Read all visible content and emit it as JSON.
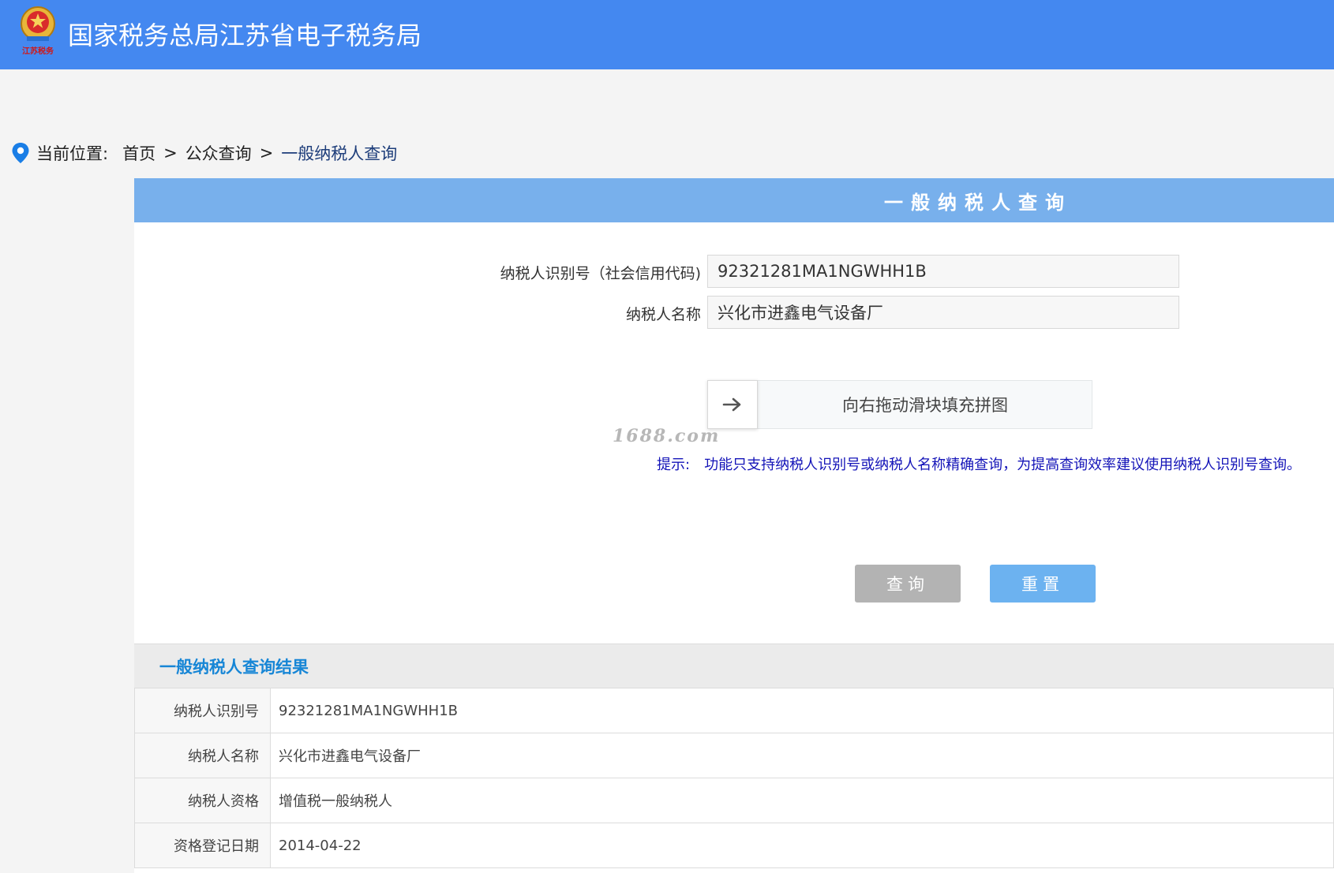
{
  "header": {
    "logo_text": "江苏税务",
    "site_title": "国家税务总局江苏省电子税务局"
  },
  "breadcrumb": {
    "label": "当前位置:",
    "items": [
      "首页",
      "公众查询",
      "一般纳税人查询"
    ],
    "separator": ">"
  },
  "form": {
    "title": "一般纳税人查询",
    "taxpayer_id_label": "纳税人识别号（社会信用代码)",
    "taxpayer_id_value": "92321281MA1NGWHH1B",
    "taxpayer_name_label": "纳税人名称",
    "taxpayer_name_value": "兴化市进鑫电气设备厂",
    "slider_text": "向右拖动滑块填充拼图",
    "watermark": "1688.com",
    "hint_label": "提示:",
    "hint_text": "功能只支持纳税人识别号或纳税人名称精确查询，为提高查询效率建议使用纳税人识别号查询。",
    "query_button": "查询",
    "reset_button": "重置"
  },
  "result": {
    "title": "一般纳税人查询结果",
    "rows": [
      {
        "label": "纳税人识别号",
        "value": "92321281MA1NGWHH1B"
      },
      {
        "label": "纳税人名称",
        "value": "兴化市进鑫电气设备厂"
      },
      {
        "label": "纳税人资格",
        "value": "增值税一般纳税人"
      },
      {
        "label": "资格登记日期",
        "value": "2014-04-22"
      }
    ]
  },
  "colors": {
    "header_bg": "#4488f0",
    "panel_head_bg": "#78b0ec",
    "hint": "#1414b8",
    "result_title": "#1786d6",
    "query_button_bg": "#b3b3b3",
    "reset_button_bg": "#6cb2f0"
  },
  "icons": {
    "breadcrumb": "location-pin-icon",
    "slider": "arrow-right-icon",
    "logo": "tax-emblem-icon"
  }
}
